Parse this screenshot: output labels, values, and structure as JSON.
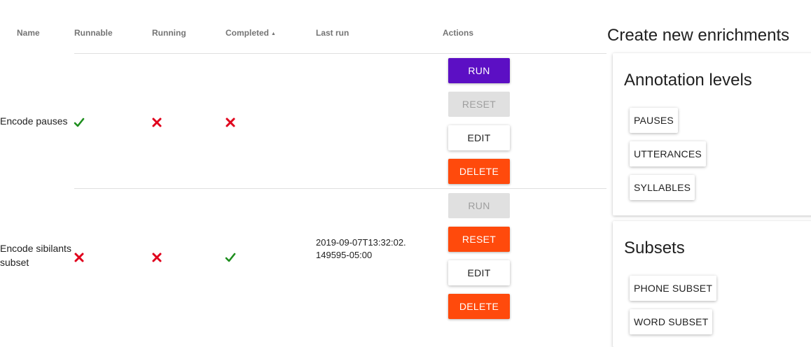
{
  "table": {
    "columns": {
      "name": "Name",
      "runnable": "Runnable",
      "running": "Running",
      "completed": "Completed",
      "last_run": "Last run",
      "actions": "Actions"
    },
    "rows": [
      {
        "name": "Encode pauses",
        "runnable": "check",
        "running": "cross",
        "completed": "cross",
        "last_run": "",
        "buttons": {
          "run": "RUN",
          "reset": "RESET",
          "edit": "EDIT",
          "delete": "DELETE"
        }
      },
      {
        "name": "Encode sibilants subset",
        "runnable": "cross",
        "running": "cross",
        "completed": "check",
        "last_run": "2019-09-07T13:32:02.149595-05:00",
        "buttons": {
          "run": "RUN",
          "reset": "RESET",
          "edit": "EDIT",
          "delete": "DELETE"
        }
      }
    ]
  },
  "panel": {
    "title": "Create new enrichments",
    "sections": [
      {
        "title": "Annotation levels",
        "buttons": [
          "PAUSES",
          "UTTERANCES",
          "SYLLABLES"
        ]
      },
      {
        "title": "Subsets",
        "buttons": [
          "PHONE SUBSET",
          "WORD SUBSET"
        ]
      }
    ]
  },
  "colors": {
    "primary": "#5c0fc4",
    "danger": "#ff4a0c",
    "check": "#1e8e1e",
    "cross": "#e0001b"
  }
}
